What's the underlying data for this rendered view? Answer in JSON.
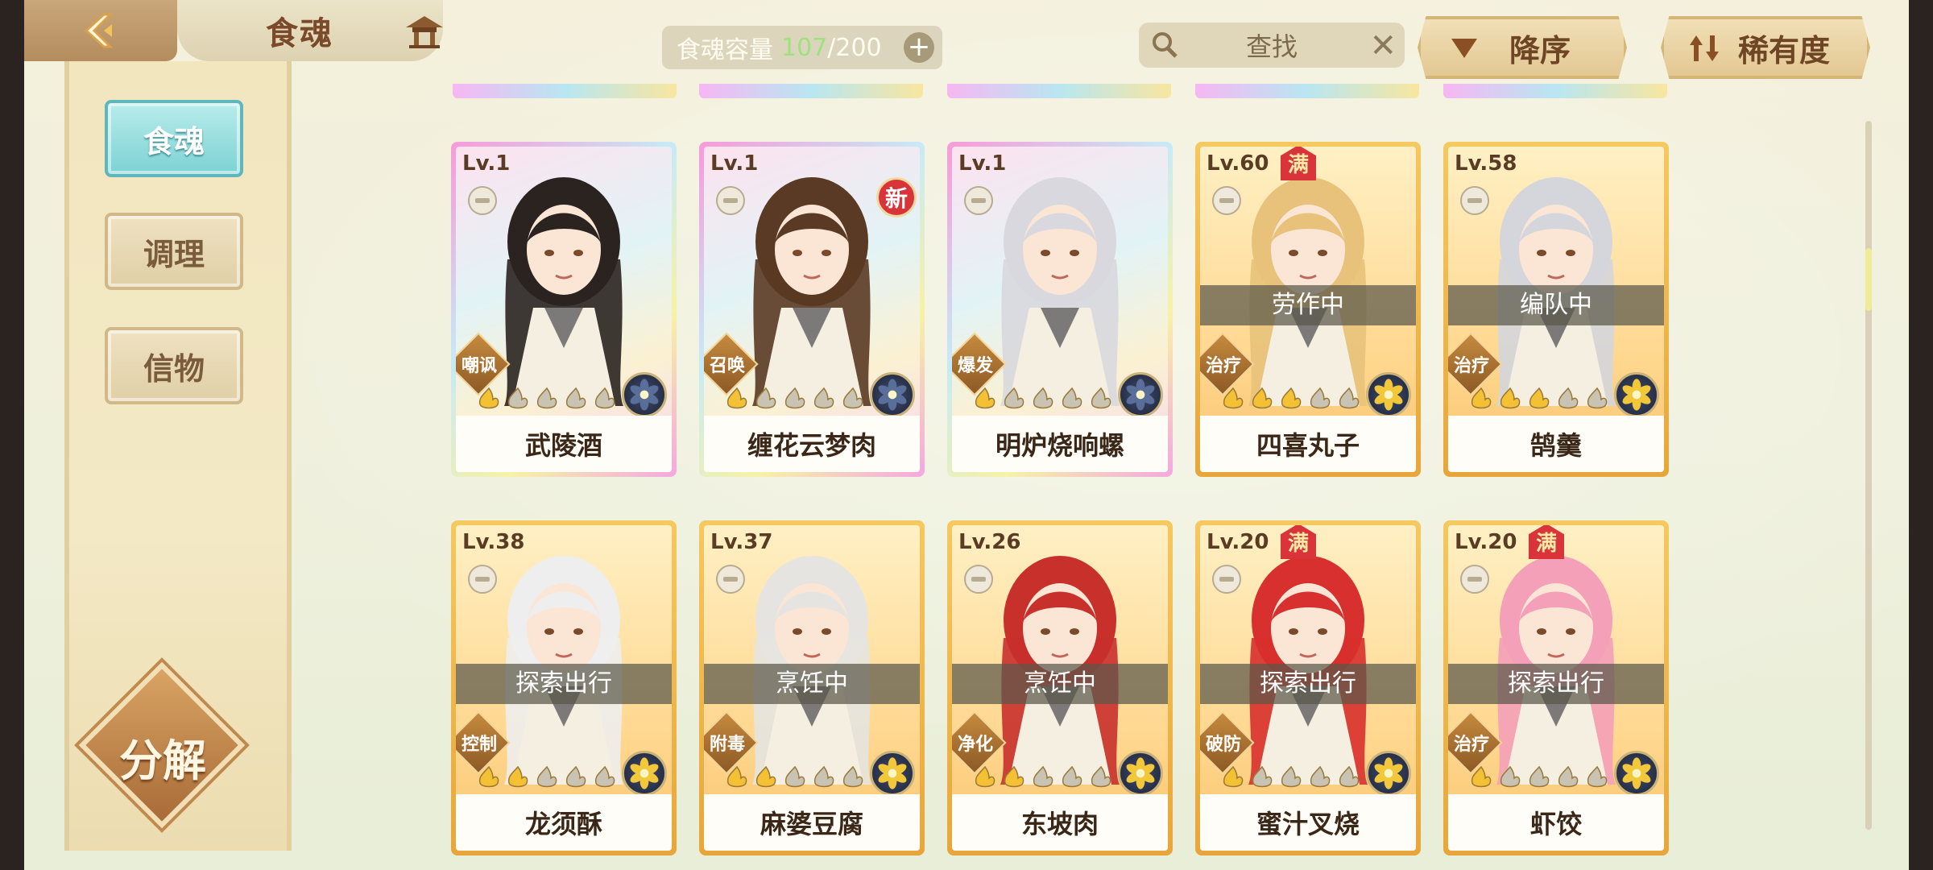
{
  "header": {
    "title": "食魂",
    "capacity_label": "食魂容量",
    "capacity_current": "107",
    "capacity_max": "/200",
    "search_label": "查找",
    "sort_order_label": "降序",
    "sort_field_label": "稀有度"
  },
  "sidebar": {
    "items": [
      {
        "label": "食魂",
        "active": true
      },
      {
        "label": "调理",
        "active": false
      },
      {
        "label": "信物",
        "active": false
      }
    ],
    "decompose_label": "分解"
  },
  "cards": [
    {
      "level": "Lv.1",
      "name": "武陵酒",
      "role": "嘲讽",
      "frame": "rainbow",
      "status": "",
      "new": false,
      "max": false,
      "stars_filled": 1,
      "stars_total": 5,
      "hair": "#2a2320",
      "element": "#5a6e9a"
    },
    {
      "level": "Lv.1",
      "name": "缠花云梦肉",
      "role": "召唤",
      "frame": "rainbow",
      "status": "",
      "new": true,
      "new_label": "新",
      "max": false,
      "stars_filled": 1,
      "stars_total": 5,
      "hair": "#5a3a24",
      "element": "#5a6e9a"
    },
    {
      "level": "Lv.1",
      "name": "明炉烧响螺",
      "role": "爆发",
      "frame": "rainbow",
      "status": "",
      "new": false,
      "max": false,
      "stars_filled": 1,
      "stars_total": 5,
      "hair": "#d8d8de",
      "element": "#5a6e9a"
    },
    {
      "level": "Lv.60",
      "name": "四喜丸子",
      "role": "治疗",
      "frame": "gold",
      "status": "劳作中",
      "new": false,
      "max": true,
      "max_label": "满",
      "stars_filled": 3,
      "stars_total": 5,
      "hair": "#e8c27a",
      "element": "#f2c83a"
    },
    {
      "level": "Lv.58",
      "name": "鹄羹",
      "role": "治疗",
      "frame": "gold",
      "status": "编队中",
      "new": false,
      "max": false,
      "stars_filled": 3,
      "stars_total": 5,
      "hair": "#d4d6dc",
      "element": "#f2c83a"
    },
    {
      "level": "Lv.38",
      "name": "龙须酥",
      "role": "控制",
      "frame": "gold",
      "status": "探索出行",
      "new": false,
      "max": false,
      "stars_filled": 2,
      "stars_total": 5,
      "hair": "#eeeeee",
      "element": "#f2c83a"
    },
    {
      "level": "Lv.37",
      "name": "麻婆豆腐",
      "role": "附毒",
      "frame": "gold",
      "status": "烹饪中",
      "new": false,
      "max": false,
      "stars_filled": 2,
      "stars_total": 5,
      "hair": "#e6e4e0",
      "element": "#f2c83a"
    },
    {
      "level": "Lv.26",
      "name": "东坡肉",
      "role": "净化",
      "frame": "gold",
      "status": "烹饪中",
      "new": false,
      "max": false,
      "stars_filled": 2,
      "stars_total": 5,
      "hair": "#c8302c",
      "element": "#f2c83a"
    },
    {
      "level": "Lv.20",
      "name": "蜜汁叉烧",
      "role": "破防",
      "frame": "gold",
      "status": "探索出行",
      "new": false,
      "max": true,
      "max_label": "满",
      "stars_filled": 1,
      "stars_total": 5,
      "hair": "#d8302e",
      "element": "#f2c83a"
    },
    {
      "level": "Lv.20",
      "name": "虾饺",
      "role": "治疗",
      "frame": "gold",
      "status": "探索出行",
      "new": false,
      "max": true,
      "max_label": "满",
      "stars_filled": 1,
      "stars_total": 5,
      "hair": "#f4a0b8",
      "element": "#f2c83a"
    }
  ],
  "colors": {
    "accent_teal": "#7cd2d4",
    "gold_frame": "#f6c860",
    "status_bar": "#5a584a",
    "badge_red": "#d8343a"
  }
}
